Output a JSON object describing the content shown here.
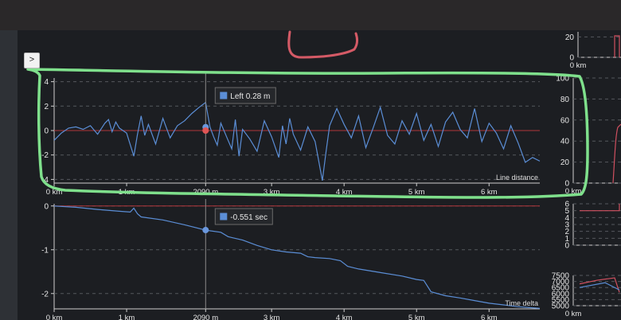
{
  "expand_button": {
    "label": ">"
  },
  "chart_data": [
    {
      "type": "line",
      "title": "",
      "xlabel": "",
      "ylabel": "",
      "annotation": "Line distance",
      "x_unit": "km",
      "x_ticks": [
        "0 km",
        "1 km",
        "2090 m",
        "3 km",
        "4 km",
        "5 km",
        "6 km"
      ],
      "y_ticks": [
        "-4",
        "-2",
        "0",
        "2",
        "4"
      ],
      "xlim": [
        0,
        6.7
      ],
      "ylim": [
        -4.3,
        4.3
      ],
      "cursor": {
        "x": 2.09,
        "label": "Left 0.28 m"
      },
      "series": [
        {
          "x": [
            0,
            0.1,
            0.2,
            0.3,
            0.4,
            0.5,
            0.6,
            0.7,
            0.75,
            0.8,
            0.85,
            0.9,
            1.0,
            1.1,
            1.15,
            1.2,
            1.25,
            1.3,
            1.4,
            1.5,
            1.55,
            1.6,
            1.7,
            1.8,
            1.9,
            2.0,
            2.09,
            2.15,
            2.2,
            2.25,
            2.3,
            2.4,
            2.45,
            2.5,
            2.55,
            2.6,
            2.7,
            2.8,
            2.9,
            3.0,
            3.1,
            3.15,
            3.2,
            3.25,
            3.3,
            3.4,
            3.5,
            3.6,
            3.7,
            3.75,
            3.8,
            3.9,
            4.0,
            4.1,
            4.2,
            4.3,
            4.4,
            4.5,
            4.6,
            4.7,
            4.8,
            4.9,
            5.0,
            5.1,
            5.2,
            5.3,
            5.4,
            5.5,
            5.6,
            5.7,
            5.8,
            5.9,
            6.0,
            6.1,
            6.2,
            6.3,
            6.4,
            6.5,
            6.6,
            6.7
          ],
          "values": [
            -0.8,
            -0.2,
            0.2,
            0.3,
            0.1,
            0.4,
            -0.3,
            0.6,
            0.9,
            -0.1,
            0.7,
            0.2,
            -0.2,
            -2.1,
            -0.3,
            1.2,
            -0.4,
            0.5,
            -1.1,
            1.0,
            0.2,
            -0.6,
            0.4,
            0.8,
            1.4,
            1.9,
            2.3,
            0.3,
            -0.5,
            -1.2,
            0.6,
            -0.8,
            -1.5,
            0.9,
            -2.1,
            0.1,
            -0.7,
            -1.7,
            0.8,
            -0.5,
            -2.2,
            0.4,
            -1.1,
            1.0,
            -0.3,
            -1.6,
            0.3,
            -0.9,
            -4.1,
            -1.8,
            0.4,
            1.8,
            0.5,
            -0.6,
            1.2,
            -1.4,
            0.2,
            1.9,
            -0.4,
            -1.1,
            0.8,
            -0.3,
            1.4,
            -0.8,
            0.5,
            -1.3,
            0.7,
            1.5,
            0.1,
            -0.6,
            1.8,
            -0.9,
            0.6,
            -0.2,
            -1.5,
            0.4,
            -1.0,
            -2.6,
            -2.2,
            -2.5
          ],
          "color": "#5b8ed6"
        }
      ]
    },
    {
      "type": "line",
      "title": "",
      "xlabel": "",
      "ylabel": "",
      "annotation": "Time delta",
      "x_ticks": [
        "0 km",
        "1 km",
        "2090 m",
        "3 km",
        "4 km",
        "5 km",
        "6 km"
      ],
      "y_ticks": [
        "0",
        "-1",
        "-2"
      ],
      "xlim": [
        0,
        6.7
      ],
      "ylim": [
        -2.35,
        0.05
      ],
      "cursor": {
        "x": 2.09,
        "label": "-0.551 sec"
      },
      "series": [
        {
          "x": [
            0,
            0.3,
            0.6,
            0.9,
            1.05,
            1.1,
            1.15,
            1.2,
            1.5,
            1.8,
            2.09,
            2.3,
            2.4,
            2.45,
            2.6,
            2.8,
            3.0,
            3.2,
            3.4,
            3.5,
            3.6,
            3.8,
            3.95,
            4.05,
            4.2,
            4.5,
            4.8,
            5.0,
            5.1,
            5.2,
            5.4,
            5.6,
            5.8,
            6.0,
            6.2,
            6.4,
            6.7
          ],
          "values": [
            0,
            -0.03,
            -0.08,
            -0.12,
            -0.14,
            -0.05,
            -0.18,
            -0.25,
            -0.32,
            -0.43,
            -0.551,
            -0.6,
            -0.7,
            -0.72,
            -0.78,
            -0.9,
            -1.0,
            -1.05,
            -1.08,
            -1.16,
            -1.18,
            -1.2,
            -1.25,
            -1.38,
            -1.44,
            -1.52,
            -1.6,
            -1.68,
            -1.7,
            -1.96,
            -2.05,
            -2.1,
            -2.16,
            -2.22,
            -2.26,
            -2.3,
            -2.34
          ],
          "color": "#5b8ed6"
        }
      ]
    },
    {
      "type": "line",
      "title": "",
      "xlabel": "",
      "ylabel": "",
      "x_ticks": [
        "0 km"
      ],
      "y_ticks": [
        "20",
        "0"
      ],
      "ylim": [
        0,
        25
      ]
    },
    {
      "type": "line",
      "title": "",
      "xlabel": "",
      "ylabel": "",
      "x_ticks": [
        "0 km"
      ],
      "y_ticks": [
        "100",
        "80",
        "60",
        "40",
        "20",
        "0"
      ],
      "ylim": [
        0,
        100
      ]
    },
    {
      "type": "line",
      "title": "",
      "xlabel": "",
      "ylabel": "",
      "y_ticks": [
        "6",
        "5",
        "4",
        "3",
        "2",
        "1",
        "0"
      ],
      "ylim": [
        0,
        6
      ]
    },
    {
      "type": "line",
      "title": "",
      "xlabel": "",
      "ylabel": "",
      "x_ticks": [
        "0 km"
      ],
      "y_ticks": [
        "7500",
        "7000",
        "6500",
        "6000",
        "5500",
        "5000"
      ],
      "ylim": [
        5000,
        7500
      ]
    }
  ]
}
